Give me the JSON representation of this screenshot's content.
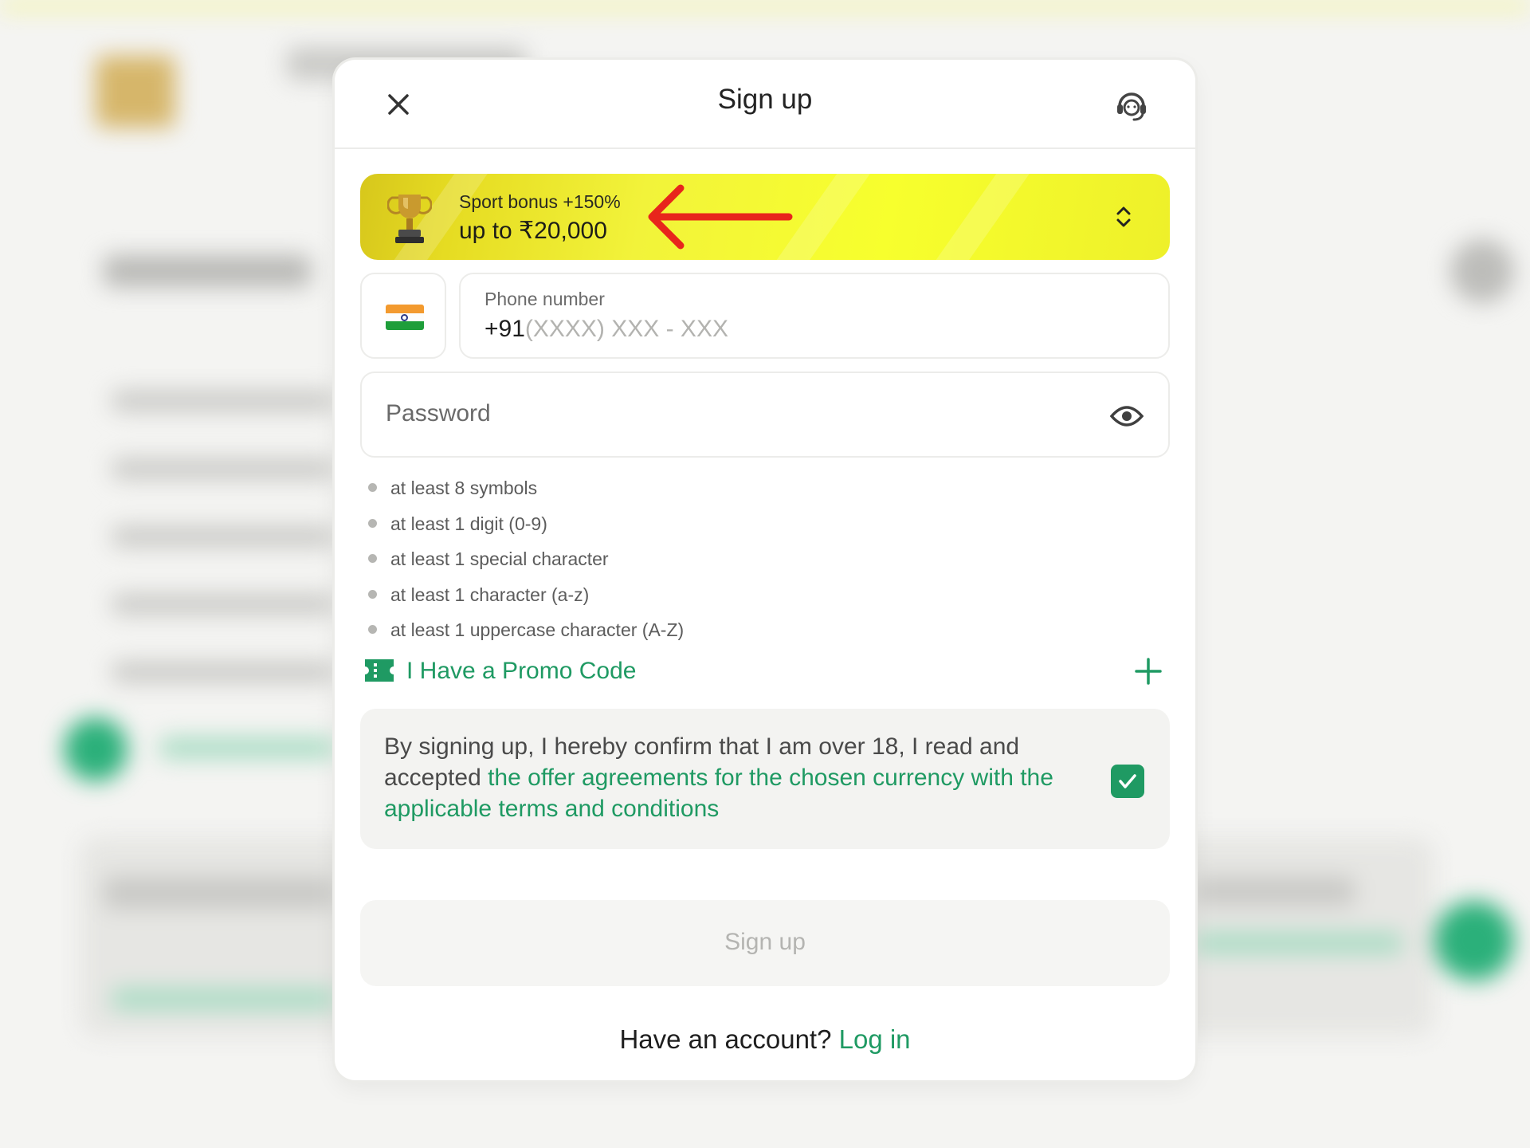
{
  "modal": {
    "title": "Sign up"
  },
  "bonus": {
    "line1": "Sport bonus +150%",
    "line2": "up to ₹20,000"
  },
  "phone": {
    "country": "India",
    "label": "Phone number",
    "prefix": "+91",
    "placeholder": "(XXXX) XXX - XXX"
  },
  "password": {
    "placeholder": "Password"
  },
  "password_rules": [
    "at least 8 symbols",
    "at least 1 digit (0-9)",
    "at least 1 special character",
    "at least 1 character (a-z)",
    "at least 1 uppercase character (A-Z)"
  ],
  "promo": {
    "label": "I Have a Promo Code"
  },
  "terms": {
    "text_before": "By signing up, I hereby confirm that I am over 18, I read and accepted ",
    "link": "the offer agreements for the chosen currency with the applicable terms and conditions",
    "checked": true
  },
  "submit": {
    "label": "Sign up"
  },
  "footer": {
    "question": "Have an account?",
    "login_label": "Log in"
  },
  "colors": {
    "accent": "#1f9a63",
    "bonus_yellow": "#f7ff2d",
    "annotation_arrow": "#e8251c"
  },
  "icons": {
    "close": "close-icon",
    "support": "headset-icon",
    "trophy": "trophy-icon",
    "annotation": "red-arrow-left",
    "toggle": "chevron-up-down-icon",
    "eye": "eye-icon",
    "promo": "ticket-icon",
    "add": "plus-icon",
    "check": "check-icon"
  }
}
